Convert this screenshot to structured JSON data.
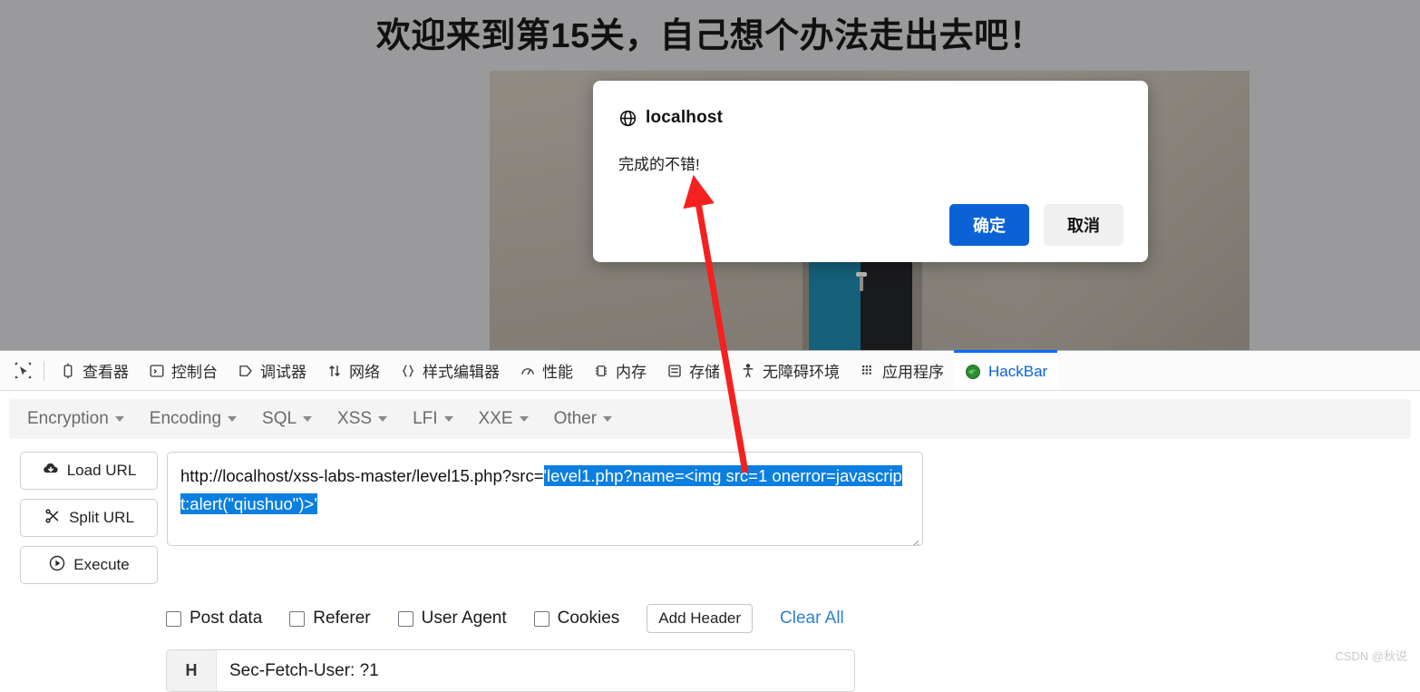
{
  "page": {
    "title": "欢迎来到第15关，自己想个办法走出去吧！",
    "background_color": "#9a9a9c",
    "photo_alt": "wall-with-teal-door-photo"
  },
  "dialog": {
    "origin": "localhost",
    "origin_icon": "globe-icon",
    "message": "完成的不错!",
    "confirm_label": "确定",
    "cancel_label": "取消",
    "confirm_color": "#0b62d6",
    "cancel_color": "#f0f0f0"
  },
  "devtools": {
    "picker_icon": "element-picker-icon",
    "tabs": [
      {
        "label": "查看器",
        "icon": "inspector-icon",
        "active": false
      },
      {
        "label": "控制台",
        "icon": "console-icon",
        "active": false
      },
      {
        "label": "调试器",
        "icon": "debugger-icon",
        "active": false
      },
      {
        "label": "网络",
        "icon": "network-icon",
        "active": false
      },
      {
        "label": "样式编辑器",
        "icon": "style-editor-icon",
        "active": false
      },
      {
        "label": "性能",
        "icon": "performance-icon",
        "active": false
      },
      {
        "label": "内存",
        "icon": "memory-icon",
        "active": false
      },
      {
        "label": "存储",
        "icon": "storage-icon",
        "active": false
      },
      {
        "label": "无障碍环境",
        "icon": "accessibility-icon",
        "active": false
      },
      {
        "label": "应用程序",
        "icon": "application-icon",
        "active": false
      },
      {
        "label": "HackBar",
        "icon": "hackbar-icon",
        "active": true
      }
    ],
    "active_tab_color": "#0b62d6",
    "active_tab_border_color": "#0a6cff"
  },
  "hackbar": {
    "menus": [
      {
        "label": "Encryption"
      },
      {
        "label": "Encoding"
      },
      {
        "label": "SQL"
      },
      {
        "label": "XSS"
      },
      {
        "label": "LFI"
      },
      {
        "label": "XXE"
      },
      {
        "label": "Other"
      }
    ],
    "actions": [
      {
        "label": "Load URL",
        "icon": "cloud-download-icon"
      },
      {
        "label": "Split URL",
        "icon": "scissors-icon"
      },
      {
        "label": "Execute",
        "icon": "play-circle-icon"
      }
    ],
    "url": {
      "prefix": "http://localhost/xss-labs-master/level15.php?src=",
      "selected": "'level1.php?name=<img src=1 onerror=javascript:alert(\"qiushuo\")>'",
      "selection_color": "#0b7fe0",
      "placeholder": "URL"
    },
    "options": [
      {
        "label": "Post data",
        "checked": false
      },
      {
        "label": "Referer",
        "checked": false
      },
      {
        "label": "User Agent",
        "checked": false
      },
      {
        "label": "Cookies",
        "checked": false
      }
    ],
    "add_header_label": "Add Header",
    "clear_all_label": "Clear All",
    "clear_all_color": "#2f7fd1",
    "headers": [
      {
        "tag": "H",
        "value": "Sec-Fetch-User: ?1"
      }
    ]
  },
  "annotation": {
    "arrow_color": "#f52020",
    "arrow_from": "url-selection",
    "arrow_to": "dialog-message"
  },
  "watermark": "CSDN @秋说"
}
